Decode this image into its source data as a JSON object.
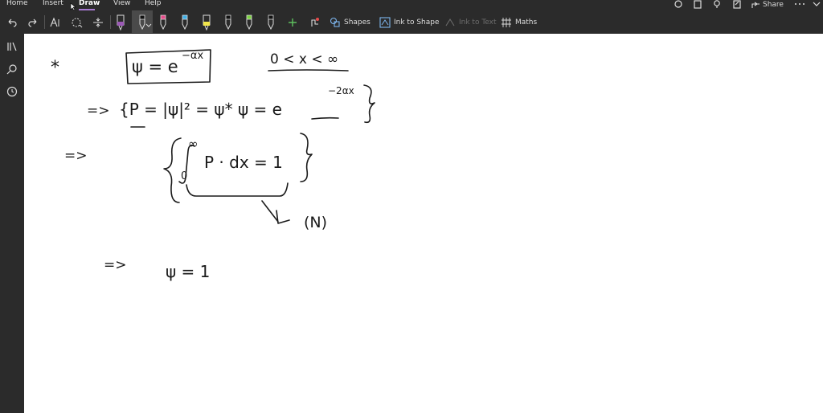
{
  "menu": {
    "tabs": [
      {
        "label": "Home"
      },
      {
        "label": "Insert"
      },
      {
        "label": "Draw"
      },
      {
        "label": "View"
      },
      {
        "label": "Help"
      }
    ],
    "active_tab": "Draw",
    "share_label": "Share"
  },
  "toolbar": {
    "shapes_label": "Shapes",
    "ink_to_shape_label": "Ink to Shape",
    "ink_to_text_label": "Ink to Text",
    "maths_label": "Maths",
    "pen_colors": [
      "#9b59b6",
      "#111111",
      "#e84b8a",
      "#3fb0e8",
      "#f2e64a",
      "#111111",
      "#7bd33f",
      "#111111"
    ],
    "accent": "#a779d1"
  },
  "note": {
    "line1": {
      "star": "*",
      "lhs": "ψ = e",
      "exp": "−αx",
      "domain": "0 < x < ∞"
    },
    "line2": {
      "arrow": "=>",
      "text": "{P = |ψ|² = ψ* ψ = e",
      "exp": "−2αx"
    },
    "line3": {
      "arrow": "=>",
      "upper": "∞",
      "integrand": "P · dx = 1",
      "lower": "0",
      "label": "(N)"
    },
    "line4": {
      "arrow": "=>",
      "text": "ψ = 1"
    }
  }
}
